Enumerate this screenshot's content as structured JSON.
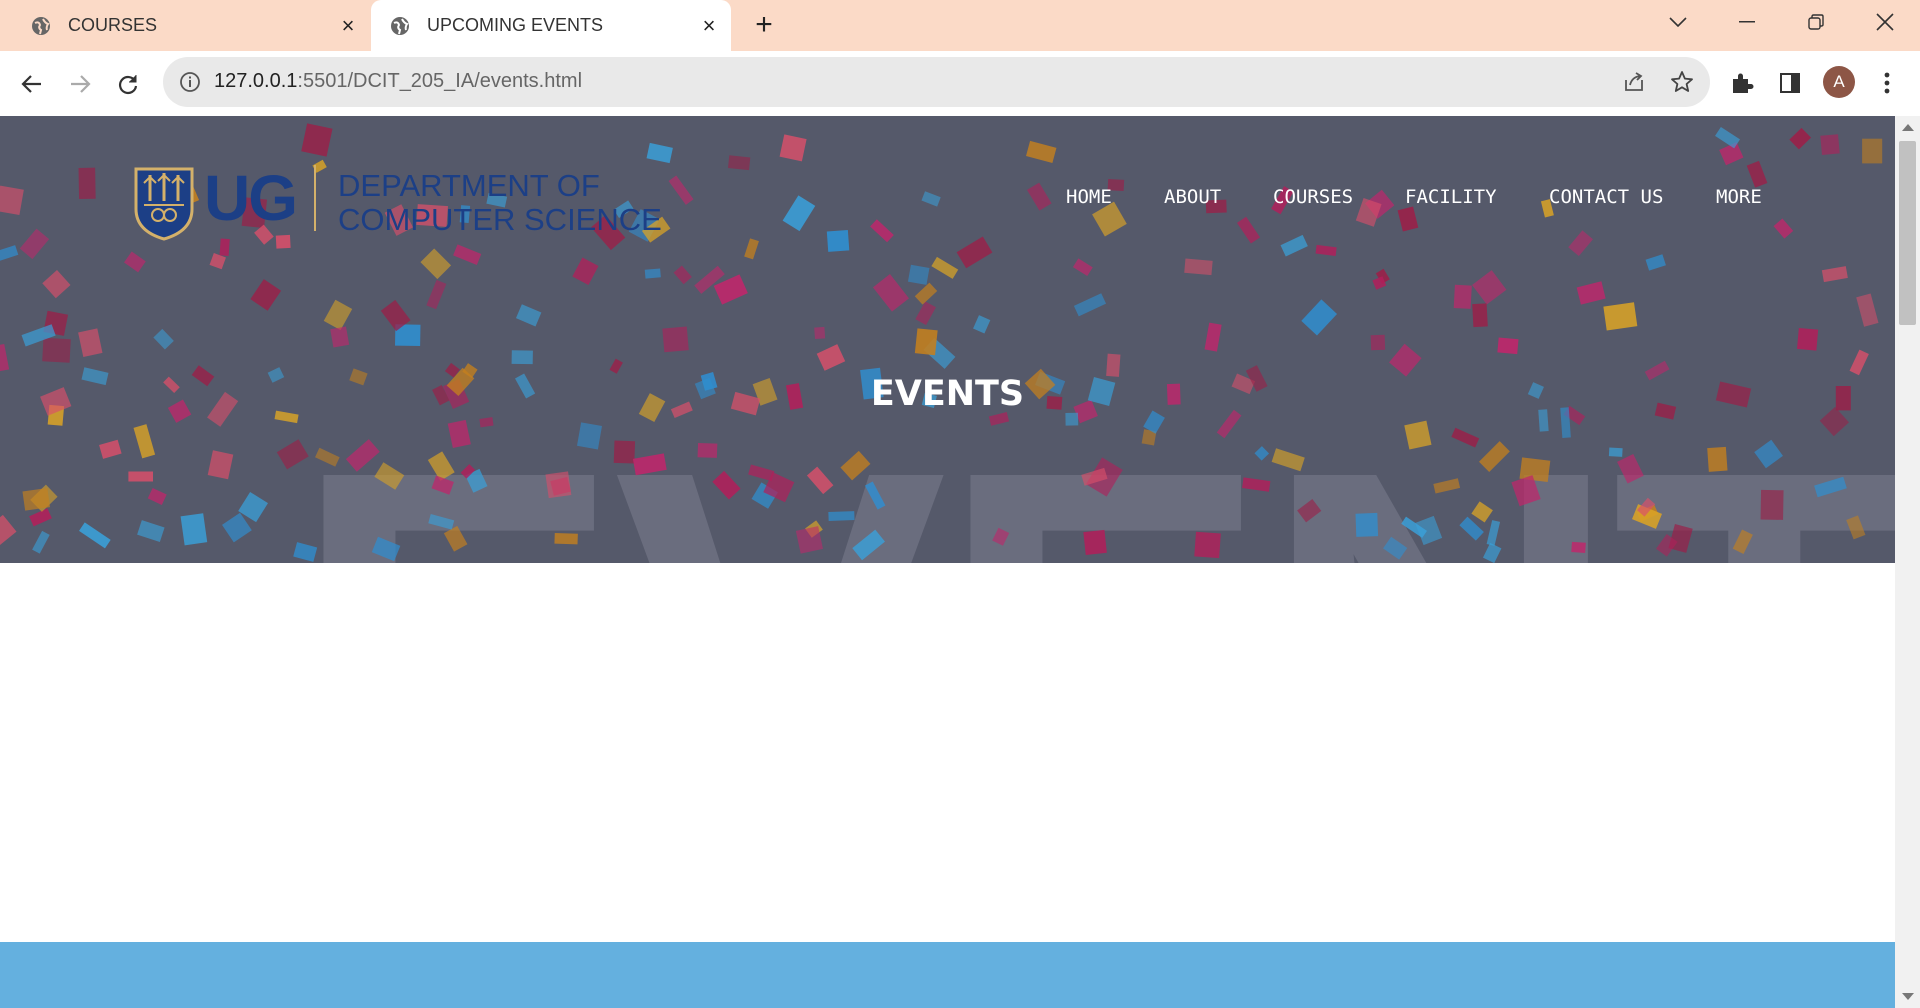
{
  "browser": {
    "tabs": [
      {
        "label": "COURSES",
        "active": false
      },
      {
        "label": "UPCOMING EVENTS",
        "active": true
      }
    ],
    "new_tab_label": "+",
    "url_host": "127.0.0.1",
    "url_path": ":5501/DCIT_205_IA/events.html",
    "profile_initial": "A",
    "tabstrip_color": "#fbdac7"
  },
  "site": {
    "logo_ug": "UG",
    "logo_dept_line1": "DEPARTMENT OF",
    "logo_dept_line2": "COMPUTER SCIENCE",
    "nav": [
      "HOME",
      "ABOUT",
      "COURSES",
      "FACILITY",
      "CONTACT US",
      "MORE"
    ],
    "hero_title": "EVENTS",
    "hero_bg_color": "#55596a",
    "accent_bar_color": "#64b0df"
  },
  "icons": [
    "globe-icon",
    "close-icon",
    "new-tab-icon",
    "chevron-down-icon",
    "minimize-icon",
    "restore-icon",
    "window-close-icon",
    "back-icon",
    "forward-icon",
    "reload-icon",
    "info-icon",
    "share-icon",
    "star-icon",
    "extensions-icon",
    "side-panel-icon",
    "kebab-menu-icon"
  ]
}
